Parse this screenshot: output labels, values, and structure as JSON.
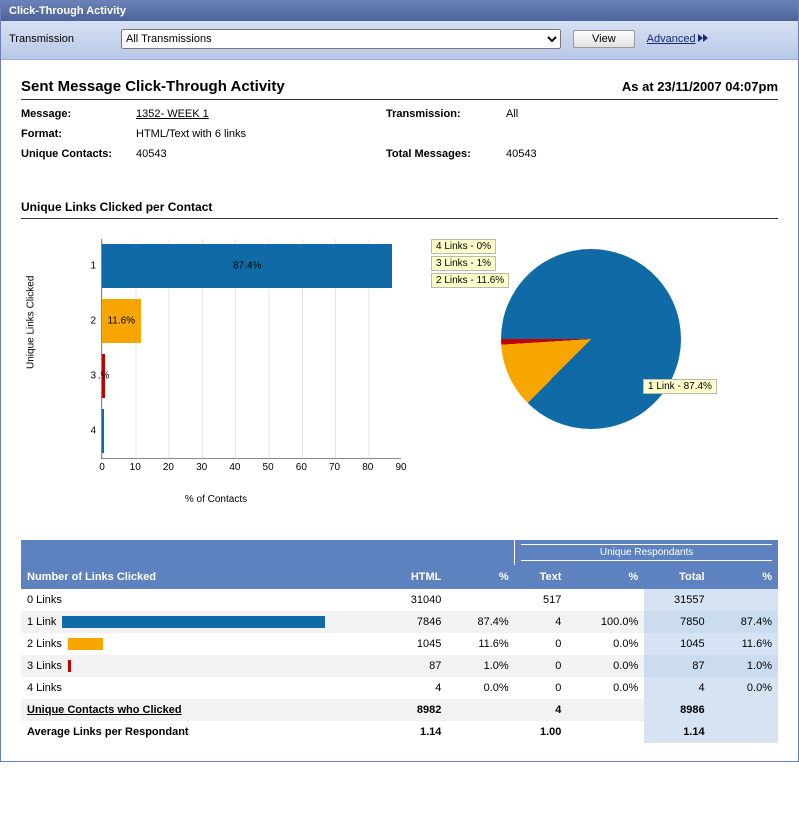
{
  "window_title": "Click-Through Activity",
  "filter": {
    "label": "Transmission",
    "selected": "All Transmissions",
    "view_label": "View",
    "advanced_label": "Advanced"
  },
  "report": {
    "title": "Sent Message Click-Through Activity",
    "asat_label": "As at 23/11/2007 04:07pm",
    "meta": {
      "message_label": "Message:",
      "message_value": "1352- WEEK 1",
      "transmission_label": "Transmission:",
      "transmission_value": "All",
      "format_label": "Format:",
      "format_value": "HTML/Text with 6 links",
      "unique_contacts_label": "Unique Contacts:",
      "unique_contacts_value": "40543",
      "total_messages_label": "Total Messages:",
      "total_messages_value": "40543"
    },
    "section_title": "Unique Links Clicked per Contact"
  },
  "chart_data": [
    {
      "type": "bar",
      "orientation": "horizontal",
      "categories": [
        "1",
        "2",
        "3",
        "4"
      ],
      "values": [
        87.4,
        11.6,
        1.0,
        0.0
      ],
      "value_labels": [
        "87.4%",
        "11.6%",
        ".%",
        ""
      ],
      "colors": [
        "#0f6aa6",
        "#f7a600",
        "#c00000",
        "#0f6aa6"
      ],
      "xlabel": "% of Contacts",
      "ylabel": "Unique Links Clicked",
      "xlim": [
        0,
        90
      ],
      "xticks": [
        0,
        10,
        20,
        30,
        40,
        50,
        60,
        70,
        80,
        90
      ]
    },
    {
      "type": "pie",
      "series": [
        {
          "name": "1 Link",
          "value": 87.4,
          "color": "#0f6aa6",
          "label": "1 Link - 87.4%"
        },
        {
          "name": "2 Links",
          "value": 11.6,
          "color": "#f7a600",
          "label": "2 Links - 11.6%"
        },
        {
          "name": "3 Links",
          "value": 1.0,
          "color": "#c00000",
          "label": "3 Links - 1%"
        },
        {
          "name": "4 Links",
          "value": 0.0,
          "color": "#0f6aa6",
          "label": "4 Links - 0%"
        }
      ]
    }
  ],
  "table": {
    "group_header": "Unique Respondants",
    "columns": {
      "links": "Number of Links Clicked",
      "html": "HTML",
      "html_pct": "%",
      "text": "Text",
      "text_pct": "%",
      "total": "Total",
      "total_pct": "%"
    },
    "rows": [
      {
        "label": "0 Links",
        "bar_pct": 0,
        "bar_color": "",
        "html": "31040",
        "html_pct": "",
        "text": "517",
        "text_pct": "",
        "total": "31557",
        "total_pct": ""
      },
      {
        "label": "1 Link",
        "bar_pct": 87.4,
        "bar_color": "#0f6aa6",
        "html": "7846",
        "html_pct": "87.4%",
        "text": "4",
        "text_pct": "100.0%",
        "total": "7850",
        "total_pct": "87.4%"
      },
      {
        "label": "2 Links",
        "bar_pct": 11.6,
        "bar_color": "#f7a600",
        "html": "1045",
        "html_pct": "11.6%",
        "text": "0",
        "text_pct": "0.0%",
        "total": "1045",
        "total_pct": "11.6%"
      },
      {
        "label": "3 Links",
        "bar_pct": 1.0,
        "bar_color": "#c00000",
        "html": "87",
        "html_pct": "1.0%",
        "text": "0",
        "text_pct": "0.0%",
        "total": "87",
        "total_pct": "1.0%"
      },
      {
        "label": "4 Links",
        "bar_pct": 0.0,
        "bar_color": "#0f6aa6",
        "html": "4",
        "html_pct": "0.0%",
        "text": "0",
        "text_pct": "0.0%",
        "total": "4",
        "total_pct": "0.0%"
      }
    ],
    "summary": {
      "label": "Unique Contacts who Clicked",
      "html": "8982",
      "text": "4",
      "total": "8986"
    },
    "average": {
      "label": "Average Links per Respondant",
      "html": "1.14",
      "text": "1.00",
      "total": "1.14"
    }
  }
}
